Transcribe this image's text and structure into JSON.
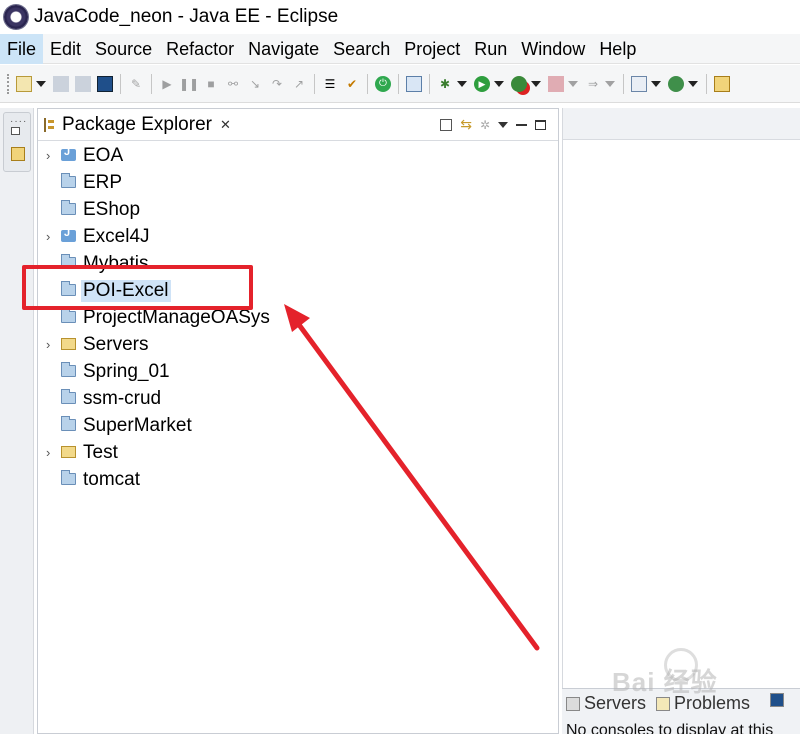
{
  "window": {
    "title": "JavaCode_neon - Java EE - Eclipse"
  },
  "menu": [
    "File",
    "Edit",
    "Source",
    "Refactor",
    "Navigate",
    "Search",
    "Project",
    "Run",
    "Window",
    "Help"
  ],
  "package_explorer": {
    "title": "Package Explorer",
    "close_glyph": "✕",
    "items": [
      {
        "label": "EOA",
        "expandable": true,
        "icon": "java-project-icon"
      },
      {
        "label": "ERP",
        "expandable": false,
        "icon": "folder-icon"
      },
      {
        "label": "EShop",
        "expandable": false,
        "icon": "folder-icon"
      },
      {
        "label": "Excel4J",
        "expandable": true,
        "icon": "java-project-icon"
      },
      {
        "label": "Mybatis",
        "expandable": false,
        "icon": "folder-icon"
      },
      {
        "label": "POI-Excel",
        "expandable": false,
        "icon": "folder-icon",
        "selected": true
      },
      {
        "label": "ProjectManageOASys",
        "expandable": false,
        "icon": "folder-icon"
      },
      {
        "label": "Servers",
        "expandable": true,
        "icon": "open-folder-icon"
      },
      {
        "label": "Spring_01",
        "expandable": false,
        "icon": "folder-icon"
      },
      {
        "label": "ssm-crud",
        "expandable": false,
        "icon": "folder-icon"
      },
      {
        "label": "SuperMarket",
        "expandable": false,
        "icon": "folder-icon"
      },
      {
        "label": "Test",
        "expandable": true,
        "icon": "open-folder-icon"
      },
      {
        "label": "tomcat",
        "expandable": false,
        "icon": "folder-icon"
      }
    ]
  },
  "bottom_panel": {
    "tabs": [
      "Servers",
      "Problems"
    ],
    "console_text": "No consoles to display at this"
  },
  "watermark": "Bai 经验",
  "colors": {
    "highlight": "#e4222b",
    "selection": "#cfe3f7",
    "menu_active": "#cce4f7"
  }
}
